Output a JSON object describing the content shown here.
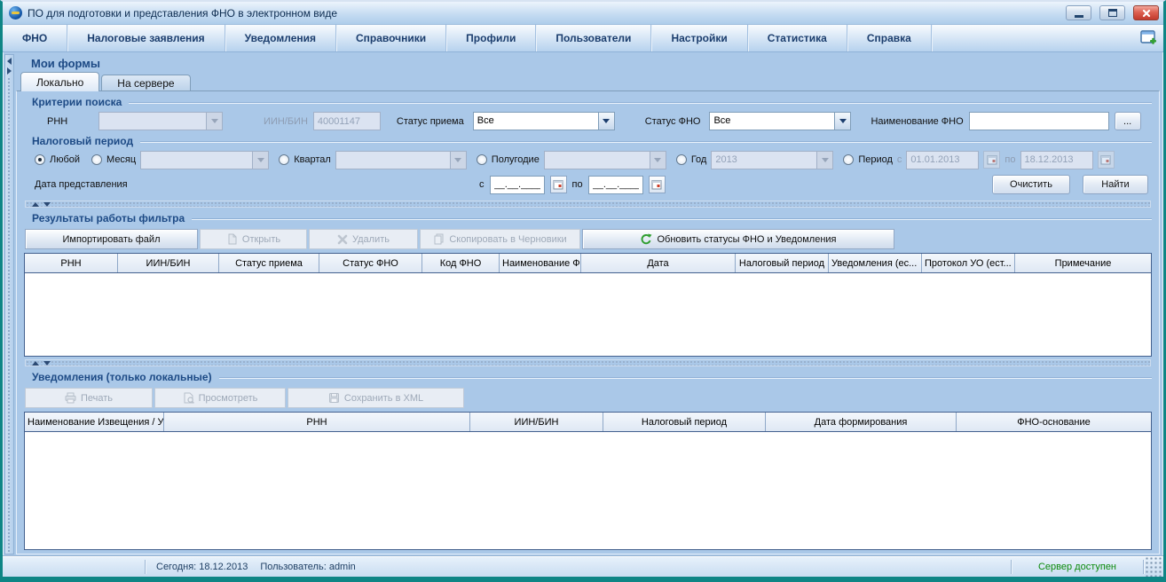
{
  "window": {
    "title": "ПО для подготовки и представления ФНО в электронном виде"
  },
  "menu": {
    "items": [
      "ФНО",
      "Налоговые заявления",
      "Уведомления",
      "Справочники",
      "Профили",
      "Пользователи",
      "Настройки",
      "Статистика",
      "Справка"
    ]
  },
  "page": {
    "title": "Мои формы"
  },
  "tabs": [
    {
      "label": "Локально",
      "active": true
    },
    {
      "label": "На сервере",
      "active": false
    }
  ],
  "criteria": {
    "title": "Критерии поиска",
    "rnn": {
      "label": "РНН",
      "value": ""
    },
    "iin": {
      "label": "ИИН/БИН",
      "value": "40001147"
    },
    "status_priema": {
      "label": "Статус приема",
      "value": "Все"
    },
    "status_fno": {
      "label": "Статус ФНО",
      "value": "Все"
    },
    "fno_name": {
      "label": "Наименование ФНО",
      "value": "",
      "browse": "..."
    },
    "tax_period": {
      "title": "Налоговый период",
      "options": [
        {
          "label": "Любой",
          "selected": true
        },
        {
          "label": "Месяц",
          "selected": false,
          "value": ""
        },
        {
          "label": "Квартал",
          "selected": false,
          "value": ""
        },
        {
          "label": "Полугодие",
          "selected": false,
          "value": ""
        },
        {
          "label": "Год",
          "selected": false,
          "value": "2013"
        },
        {
          "label": "Период",
          "selected": false,
          "from_label": "с",
          "from": "01.01.2013",
          "to_label": "по",
          "to": "18.12.2013"
        }
      ]
    },
    "submit_date": {
      "label": "Дата представления",
      "from_label": "с",
      "from_value": "__.__.____",
      "to_label": "по",
      "to_value": "__.__.____"
    },
    "clear_button": "Очистить",
    "find_button": "Найти"
  },
  "results": {
    "title": "Результаты работы фильтра",
    "buttons": {
      "import": "Импортировать файл",
      "open": "Открыть",
      "delete": "Удалить",
      "copy": "Скопировать в Черновики",
      "refresh": "Обновить статусы ФНО и Уведомления"
    },
    "columns": [
      "РНН",
      "ИИН/БИН",
      "Статус приема",
      "Статус ФНО",
      "Код ФНО",
      "Наименование Ф...",
      "Дата",
      "Налоговый период",
      "Уведомления (ес...",
      "Протокол УО (ест...",
      "Примечание"
    ],
    "rows": []
  },
  "notifications": {
    "title": "Уведомления (только локальные)",
    "buttons": {
      "print": "Печать",
      "view": "Просмотреть",
      "save_xml": "Сохранить в XML"
    },
    "columns": [
      "Наименование Извещения / Увед...",
      "РНН",
      "ИИН/БИН",
      "Налоговый период",
      "Дата формирования",
      "ФНО-основание"
    ],
    "rows": []
  },
  "statusbar": {
    "today": "Сегодня: 18.12.2013",
    "user": "Пользователь: admin",
    "server_status": "Сервер доступен"
  },
  "icons": {
    "app": "globe-icon",
    "minimize": "minimize-icon",
    "maximize": "maximize-icon",
    "close": "close-icon",
    "new_window": "new-window-icon",
    "open": "document-icon",
    "delete": "delete-x-icon",
    "copy": "copy-documents-icon",
    "refresh": "refresh-icon",
    "print": "printer-icon",
    "view": "preview-icon",
    "save_xml": "save-icon",
    "calendar": "calendar-icon",
    "dropdown": "chevron-down-icon"
  },
  "colors": {
    "frame": "#0E8585",
    "section_title": "#1D4A85",
    "menu_text": "#1C3E6E",
    "server_ok": "#0B8A0B",
    "table_border": "#44618F",
    "disabled_text": "#96A3B6"
  }
}
